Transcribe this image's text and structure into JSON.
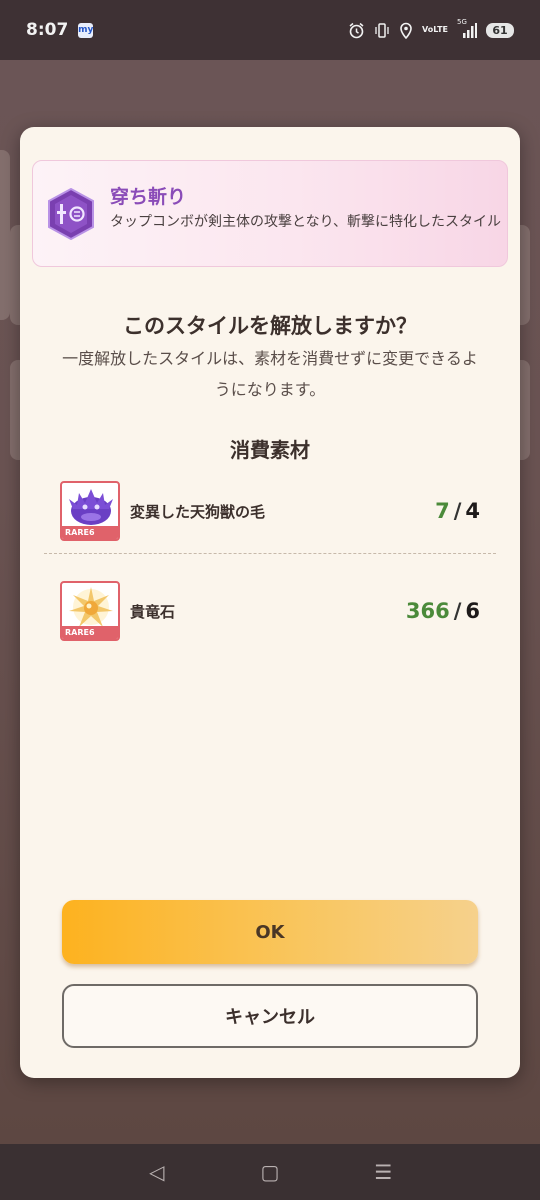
{
  "status_bar": {
    "time": "8:07",
    "app_icon_text": "my",
    "volte_top": "Vo",
    "volte_bottom": "LTE",
    "network": "5G",
    "battery": "61",
    "icons": [
      "alarm-icon",
      "vibrate-icon",
      "location-icon",
      "volte-icon",
      "signal-icon",
      "battery-icon"
    ]
  },
  "dialog": {
    "style": {
      "name": "穿ち斬り",
      "description": "タップコンボが剣主体の攻撃となり、斬撃に特化したスタイル",
      "emblem_icon": "sword-hexagon-icon"
    },
    "confirm_title": "このスタイルを解放しますか？",
    "confirm_description": "一度解放したスタイルは、素材を消費せずに変更できるようになります。",
    "materials_heading": "消費素材",
    "materials": [
      {
        "name": "変異した天狗獣の毛",
        "rarity": "RARE6",
        "have": "7",
        "separator": "/",
        "need": "4",
        "icon": "purple-fur-icon"
      },
      {
        "name": "貴竜石",
        "rarity": "RARE6",
        "have": "366",
        "separator": "/",
        "need": "6",
        "icon": "dragon-stone-icon"
      }
    ],
    "ok_label": "OK",
    "cancel_label": "キャンセル"
  },
  "nav_bar": {
    "back": "◁",
    "home": "▢",
    "recents": "☰"
  },
  "colors": {
    "accent_orange": "#fdb21f",
    "have_green": "#4b8a3a",
    "style_name_purple": "#8a4cb8",
    "rarity_red": "#e0626a"
  }
}
